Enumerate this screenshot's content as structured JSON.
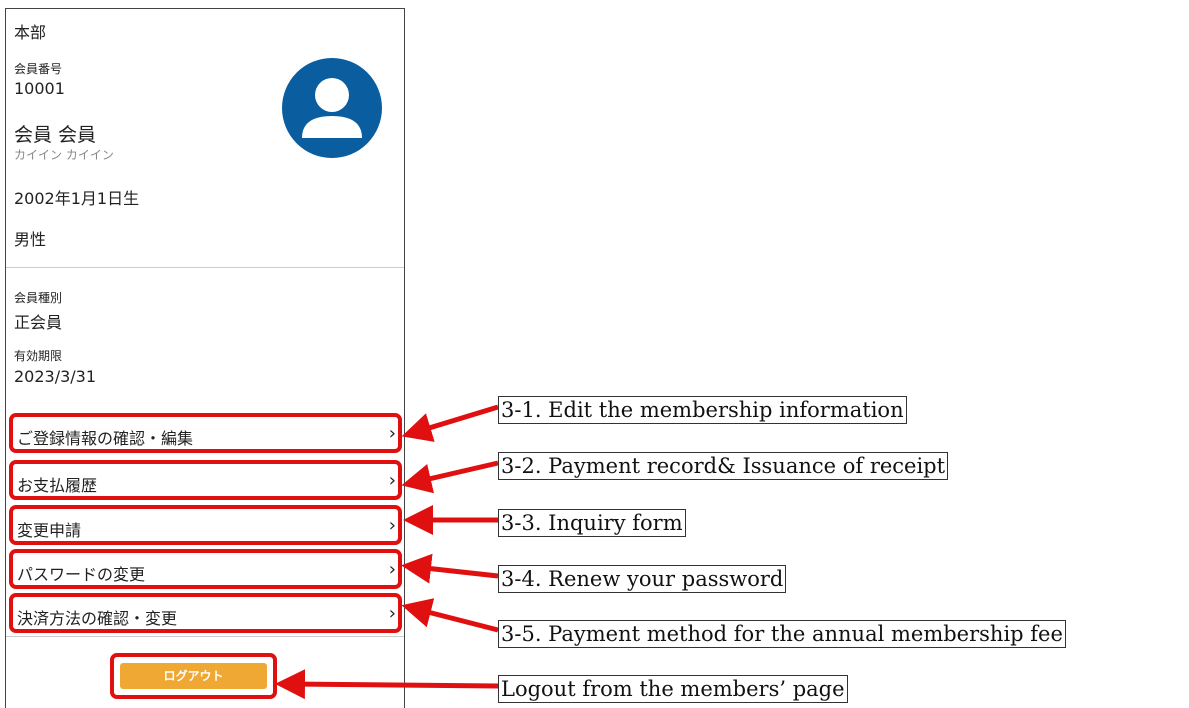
{
  "profile": {
    "organization": "本部",
    "member_number_label": "会員番号",
    "member_number": "10001",
    "name": "会員 会員",
    "name_kana": "カイイン カイイン",
    "birthdate": "2002年1月1日生",
    "gender": "男性",
    "member_type_label": "会員種別",
    "member_type": "正会員",
    "expiry_label": "有効期限",
    "expiry": "2023/3/31"
  },
  "menu": [
    {
      "label": "ご登録情報の確認・編集",
      "icon": "chevron-right-icon"
    },
    {
      "label": "お支払履歴",
      "icon": "chevron-right-icon"
    },
    {
      "label": "変更申請",
      "icon": "chevron-right-icon"
    },
    {
      "label": "パスワードの変更",
      "icon": "chevron-right-icon"
    },
    {
      "label": "決済方法の確認・変更",
      "icon": "chevron-right-icon"
    }
  ],
  "logout_label": "ログアウト",
  "annotations": [
    "3-1. Edit the membership information",
    "3-2. Payment record& Issuance of receipt",
    "3-3. Inquiry form",
    "3-4. Renew your password",
    "3-5. Payment method for the annual membership fee",
    "Logout from the members’ page"
  ],
  "colors": {
    "highlight": "#e01010",
    "avatar": "#0a5d9f",
    "logout_button": "#f0a834"
  }
}
